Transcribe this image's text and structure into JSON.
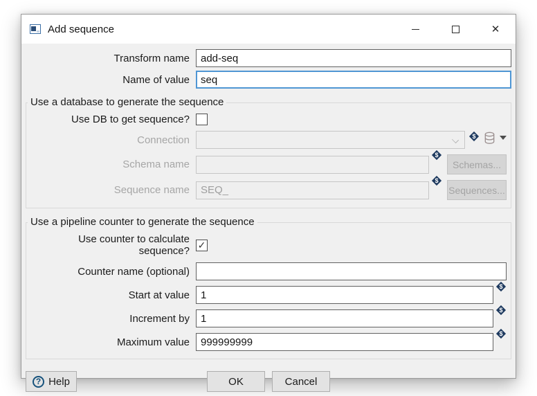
{
  "titlebar": {
    "title": "Add sequence"
  },
  "rows": {
    "transform_name": {
      "label": "Transform name",
      "value": "add-seq"
    },
    "name_of_value": {
      "label": "Name of value",
      "value": "seq"
    }
  },
  "db_group": {
    "title": "Use a database to generate the sequence",
    "use_db_label": "Use DB to get sequence?",
    "use_db_checked": false,
    "connection_label": "Connection",
    "connection_value": "",
    "schema_label": "Schema name",
    "schema_value": "",
    "schemas_button": "Schemas...",
    "sequence_label": "Sequence name",
    "sequence_value": "SEQ_",
    "sequences_button": "Sequences..."
  },
  "counter_group": {
    "title": "Use a pipeline counter to generate the sequence",
    "use_counter_label": "Use counter to calculate sequence?",
    "use_counter_checked": true,
    "counter_name_label": "Counter name (optional)",
    "counter_name_value": "",
    "start_label": "Start at value",
    "start_value": "1",
    "increment_label": "Increment by",
    "increment_value": "1",
    "max_label": "Maximum value",
    "max_value": "999999999"
  },
  "footer": {
    "help": "Help",
    "ok": "OK",
    "cancel": "Cancel"
  },
  "icons": {
    "variable": "$",
    "checkmark": "✓",
    "close": "✕",
    "help_qmark": "?"
  },
  "colors": {
    "focus_border": "#4f96d4",
    "variable_icon_bg": "#1e3a5f",
    "titlebar_bg": "#ffffff",
    "dialog_bg": "#f0f0f0"
  }
}
